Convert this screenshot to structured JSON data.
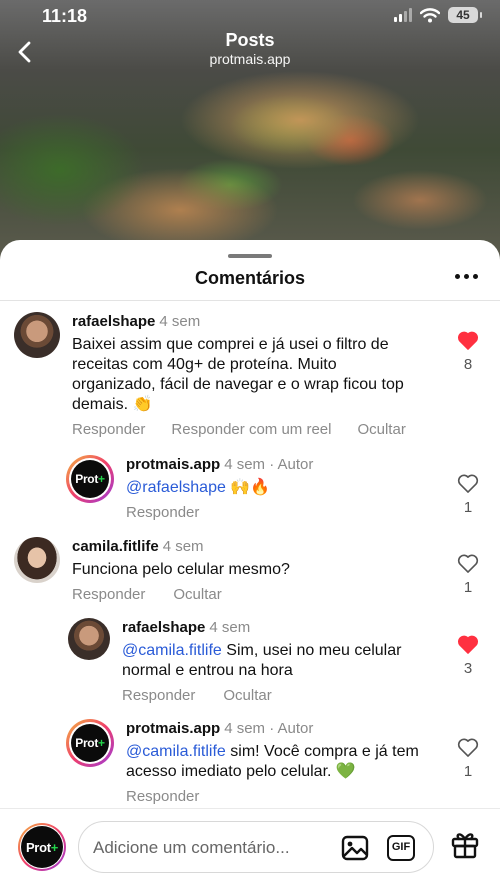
{
  "status_bar": {
    "time": "11:18",
    "battery": "45"
  },
  "nav": {
    "title": "Posts",
    "subtitle": "protmais.app"
  },
  "sheet": {
    "title": "Comentários"
  },
  "brand_avatar": {
    "text": "Prot",
    "plus": "+"
  },
  "comments": [
    {
      "user": "rafaelshape",
      "time": "4 sem",
      "text": "Baixei assim que comprei e já usei o filtro de receitas com 40g+ de proteína. Muito organizado, fácil de navegar e o wrap ficou top demais. 👏",
      "actions": [
        "Responder",
        "Responder com um reel",
        "Ocultar"
      ],
      "likes": "8",
      "liked": true
    },
    {
      "user": "protmais.app",
      "time": "4 sem · Autor",
      "mention": "@rafaelshape",
      "text": " 🙌🔥",
      "actions": [
        "Responder"
      ],
      "likes": "1",
      "liked": false
    },
    {
      "user": "camila.fitlife",
      "time": "4 sem",
      "text": "Funciona pelo celular mesmo?",
      "actions": [
        "Responder",
        "Ocultar"
      ],
      "likes": "1",
      "liked": false
    },
    {
      "user": "rafaelshape",
      "time": "4 sem",
      "mention": "@camila.fitlife",
      "text": " Sim, usei no meu celular normal e entrou na hora",
      "actions": [
        "Responder",
        "Ocultar"
      ],
      "likes": "3",
      "liked": true
    },
    {
      "user": "protmais.app",
      "time": "4 sem · Autor",
      "mention": "@camila.fitlife",
      "text": " sim! Você compra e já tem acesso imediato pelo celular. 💚",
      "actions": [
        "Responder"
      ],
      "likes": "1",
      "liked": false
    }
  ],
  "composer": {
    "placeholder": "Adicione um comentário...",
    "gif_label": "GIF"
  },
  "colors": {
    "like_red": "#ff3040",
    "mention_blue": "#2a5bd7",
    "brand_green": "#22d24a"
  },
  "icons": [
    "back-chevron-icon",
    "more-icon",
    "heart-icon",
    "image-icon",
    "gif-icon",
    "gift-icon"
  ]
}
